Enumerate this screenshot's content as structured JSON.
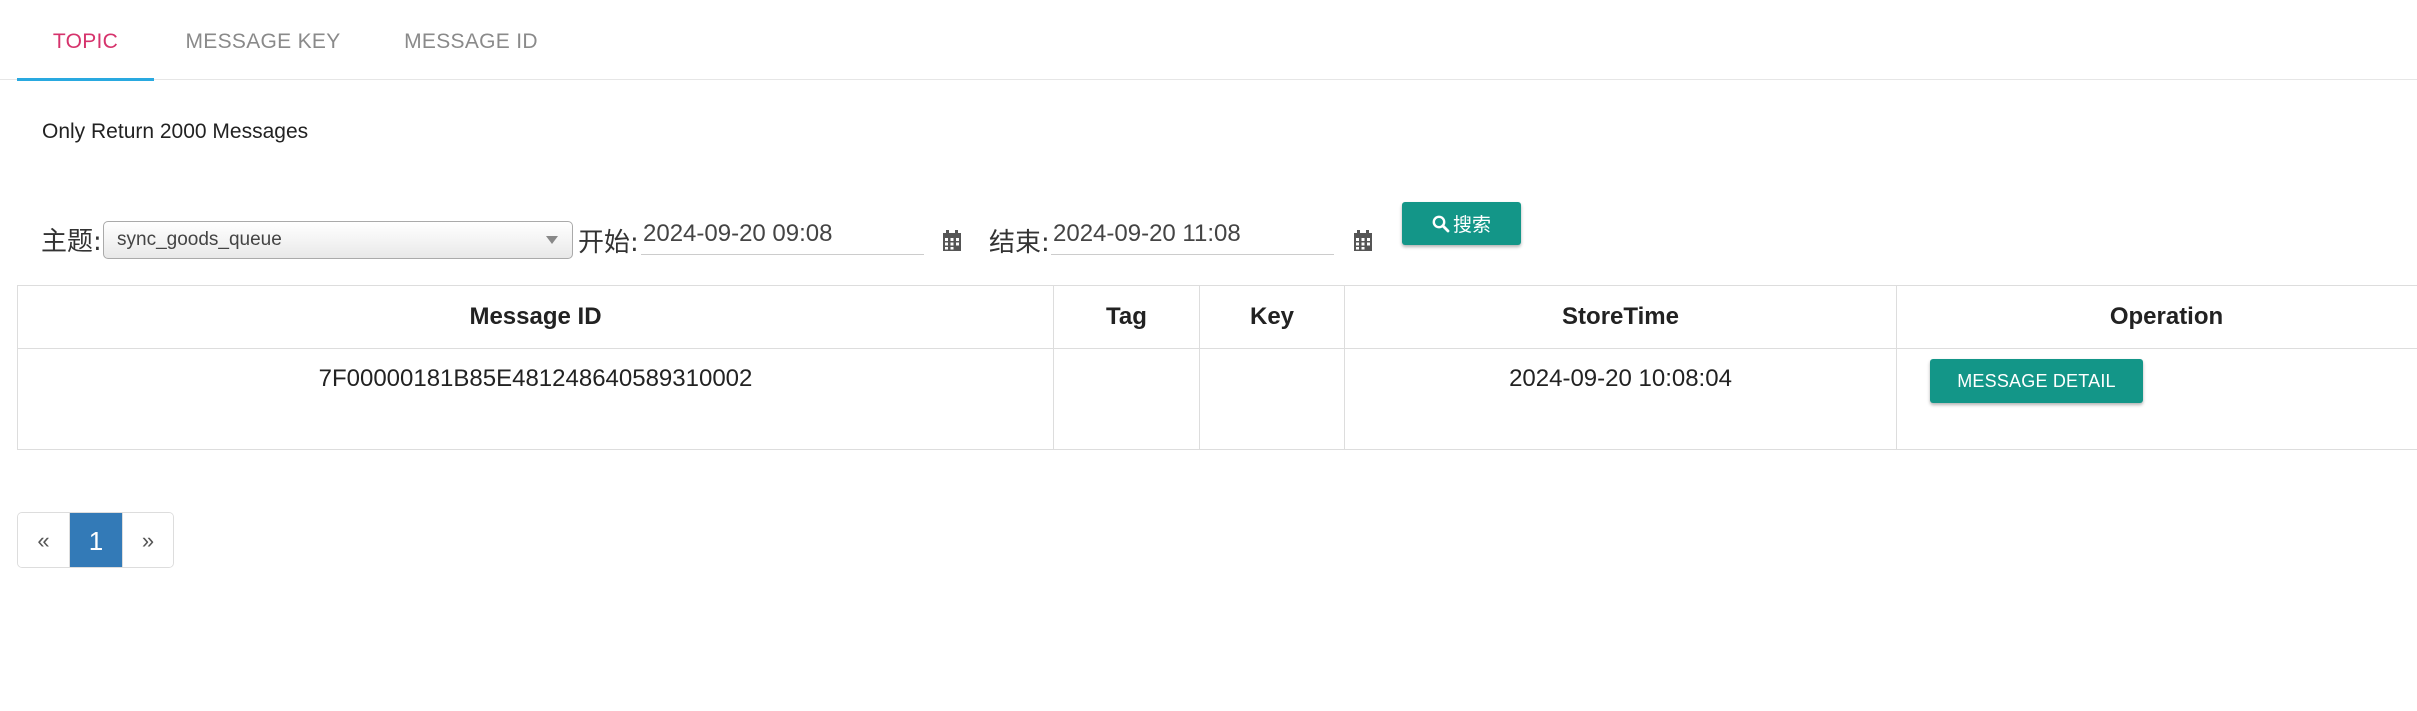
{
  "tabs": [
    {
      "label": "TOPIC",
      "active": true
    },
    {
      "label": "MESSAGE KEY",
      "active": false
    },
    {
      "label": "MESSAGE ID",
      "active": false
    }
  ],
  "notice": "Only Return 2000 Messages",
  "filters": {
    "topic_label": "主题:",
    "topic_value": "sync_goods_queue",
    "start_label": "开始:",
    "start_value": "2024-09-20 09:08",
    "end_label": "结束:",
    "end_value": "2024-09-20 11:08",
    "search_label": "搜索",
    "search_icon": "search-icon",
    "calendar_icon": "calendar-icon"
  },
  "table": {
    "columns": [
      "Message ID",
      "Tag",
      "Key",
      "StoreTime",
      "Operation"
    ],
    "rows": [
      {
        "message_id": "7F00000181B85E481248640589310002",
        "tag": "",
        "key": "",
        "store_time": "2024-09-20 10:08:04",
        "operation": "MESSAGE DETAIL"
      }
    ]
  },
  "pagination": {
    "prev": "«",
    "current": "1",
    "next": "»"
  },
  "colors": {
    "active_tab_text": "#d6336c",
    "active_tab_underline": "#29a9e0",
    "button": "#139688",
    "page_current": "#337ab7"
  }
}
